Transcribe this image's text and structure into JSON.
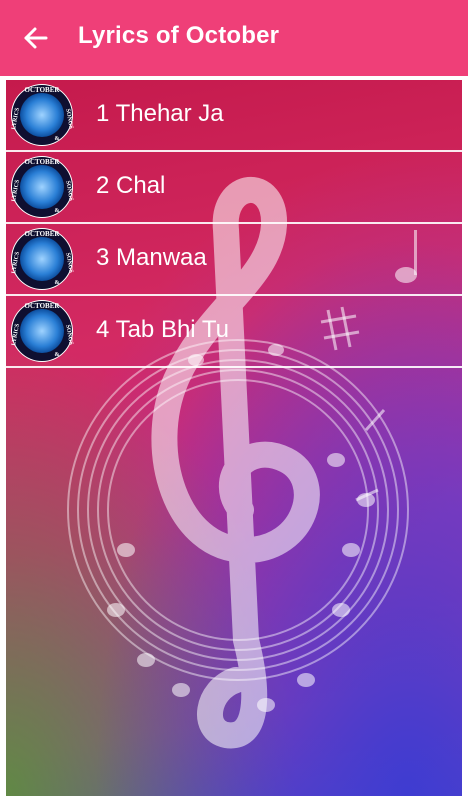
{
  "app_bar": {
    "title": "Lyrics of October",
    "back_icon": "arrow-left-icon",
    "color": "#ef3f78"
  },
  "songs": [
    {
      "label": "1 Thehar Ja"
    },
    {
      "label": "2 Chal"
    },
    {
      "label": "3 Manwaa"
    },
    {
      "label": "4 Tab Bhi Tu"
    }
  ],
  "logo": {
    "icon": "october-songs-lyrics-logo-icon",
    "text_top": "OCTOBER",
    "text_right": "SONGS",
    "text_left": "LYRICS",
    "text_amp": "&"
  },
  "background": {
    "icon": "music-clef-notes-icon"
  }
}
